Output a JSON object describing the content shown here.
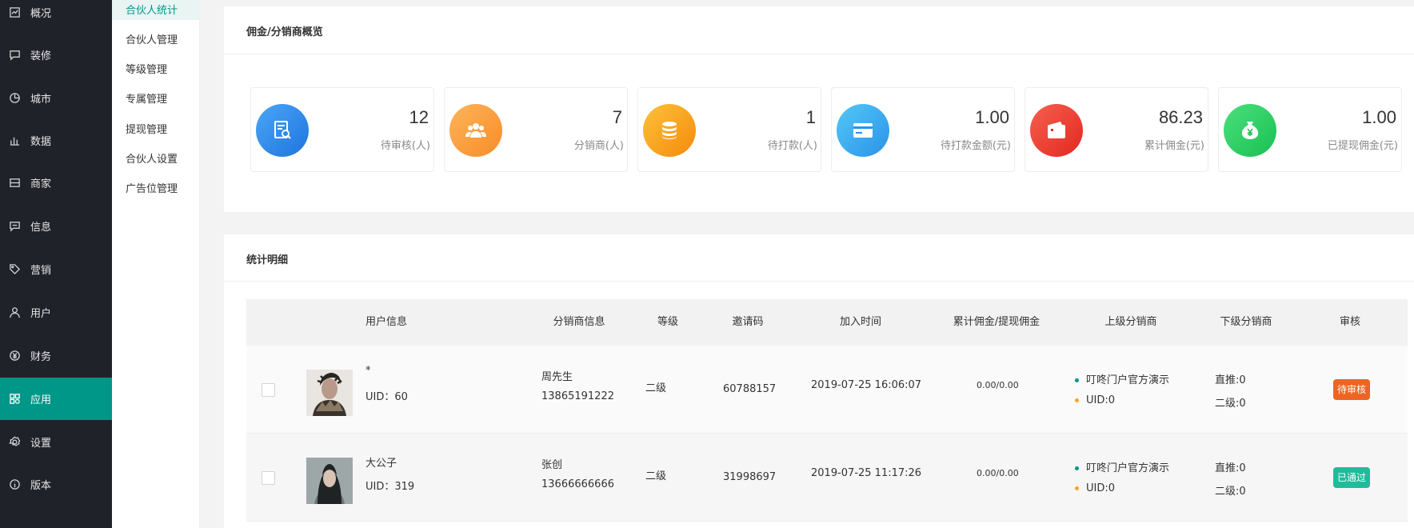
{
  "nav": [
    {
      "label": "概况",
      "icon": "chart-icon"
    },
    {
      "label": "装修",
      "icon": "message-icon"
    },
    {
      "label": "城市",
      "icon": "pie-icon"
    },
    {
      "label": "数据",
      "icon": "bar-chart-icon"
    },
    {
      "label": "商家",
      "icon": "store-icon"
    },
    {
      "label": "信息",
      "icon": "chat-icon"
    },
    {
      "label": "营销",
      "icon": "tag-icon"
    },
    {
      "label": "用户",
      "icon": "user-icon"
    },
    {
      "label": "财务",
      "icon": "yen-icon"
    },
    {
      "label": "应用",
      "icon": "apps-icon"
    },
    {
      "label": "设置",
      "icon": "gear-icon"
    },
    {
      "label": "版本",
      "icon": "info-icon"
    }
  ],
  "submenu": [
    "合伙人统计",
    "合伙人管理",
    "等级管理",
    "专属管理",
    "提现管理",
    "合伙人设置",
    "广告位管理"
  ],
  "overview": {
    "title": "佣金/分销商概览",
    "stats": [
      {
        "value": "12",
        "label": "待审核(人)",
        "color": "#2f8bea",
        "icon": "search-doc-icon"
      },
      {
        "value": "7",
        "label": "分销商(人)",
        "color": "#f9a23c",
        "icon": "users-icon"
      },
      {
        "value": "1",
        "label": "待打款(人)",
        "color": "#f8a21c",
        "icon": "coins-icon"
      },
      {
        "value": "1.00",
        "label": "待打款金额(元)",
        "color": "#3aacf0",
        "icon": "card-icon"
      },
      {
        "value": "86.23",
        "label": "累计佣金(元)",
        "color": "#ef3f36",
        "icon": "wallet-icon"
      },
      {
        "value": "1.00",
        "label": "已提现佣金(元)",
        "color": "#2ed46b",
        "icon": "money-bag-icon"
      }
    ]
  },
  "detail": {
    "title": "统计明细",
    "headers": [
      "用户信息",
      "分销商信息",
      "等级",
      "邀请码",
      "加入时间",
      "累计佣金/提现佣金",
      "上级分销商",
      "下级分销商",
      "审核"
    ],
    "rows": [
      {
        "name": "*",
        "uid": "UID：60",
        "dist_name": "周先生",
        "dist_phone": "13865191222",
        "level": "二级",
        "code": "60788157",
        "time": "2019-07-25 16:06:07",
        "commission": "0.00/0.00",
        "parent_name": "叮咚门户官方演示",
        "parent_uid": "UID:0",
        "direct": "直推:0",
        "second": "二级:0",
        "status": "待审核",
        "status_color": "#ee6423"
      },
      {
        "name": "大公子",
        "uid": "UID：319",
        "dist_name": "张创",
        "dist_phone": "13666666666",
        "level": "二级",
        "code": "31998697",
        "time": "2019-07-25 11:17:26",
        "commission": "0.00/0.00",
        "parent_name": "叮咚门户官方演示",
        "parent_uid": "UID:0",
        "direct": "直推:0",
        "second": "二级:0",
        "status": "已通过",
        "status_color": "#1fbc9c"
      }
    ],
    "dot_colors": [
      "#009688",
      "#f5a623"
    ]
  }
}
